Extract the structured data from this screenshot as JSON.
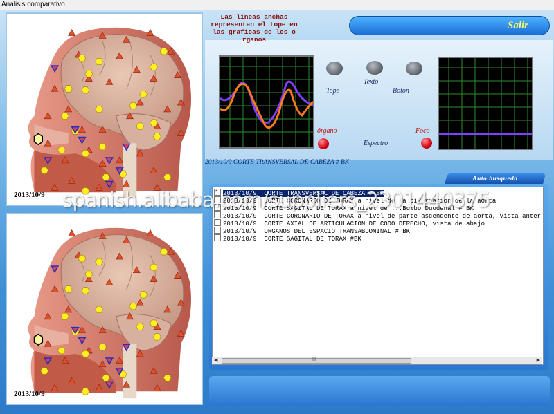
{
  "window": {
    "title": "Analisis comparativo"
  },
  "scans": [
    {
      "date": "2013/10/9"
    },
    {
      "date": "2013/10/9"
    }
  ],
  "note": {
    "lines": [
      "Las lineas anchas",
      "representan el tope en",
      "las graficas de los ó",
      "rganos"
    ]
  },
  "exit_button": {
    "label": "Salir"
  },
  "controls": {
    "tope": "Tope",
    "texto": "Texto",
    "boton": "Boton",
    "organo": "órgano",
    "espectro": "Espectro",
    "foco": "Foco"
  },
  "record_line": "2013/10/9 CORTE TRANSVERSAL DE CABEZA # BK",
  "auto_search": {
    "label": "Auto busqueda"
  },
  "list": {
    "items": [
      {
        "date": "2013/10/9",
        "text": "CORTE TRANSVERSAL DE CABEZA # BK",
        "checked": true,
        "selected": true
      },
      {
        "date": "2013/10/9",
        "text": "CORTE CORONARIO DE TORAX a nivel de la bifurcacion de la aorta",
        "checked": false,
        "selected": false
      },
      {
        "date": "2013/10/9",
        "text": "CORTE SAGITAL DE TORAX a nivel de ...Bulbo Duodenal # BK",
        "checked": false,
        "selected": false
      },
      {
        "date": "2013/10/9",
        "text": "CORTE CORONARIO DE TORAX a nivel de parte ascendente de aorta, vista anter",
        "checked": false,
        "selected": false
      },
      {
        "date": "2013/10/9",
        "text": "CORTE AXIAL DE ARTICULACION DE CODO DERECHO, vista de abajo",
        "checked": false,
        "selected": false
      },
      {
        "date": "2013/10/9",
        "text": "ORGANOS DEL ESPACIO TRANSABDOMINAL # BK",
        "checked": false,
        "selected": false
      },
      {
        "date": "2013/10/9",
        "text": "CORTE SAGITAL  DE TORAX #BK",
        "checked": false,
        "selected": false
      }
    ],
    "scroll_mark": "III"
  },
  "watermark": "spanish.alibaba.com/suppliers_2301440375",
  "colors": {
    "marker_triangle": "#e0502a",
    "marker_hexagon": "#ffee22",
    "marker_blue": "#2030c0",
    "scope_line_orange": "#ff7a1a",
    "scope_line_purple": "#8040ff",
    "scope_grid": "#2e8b2e"
  }
}
